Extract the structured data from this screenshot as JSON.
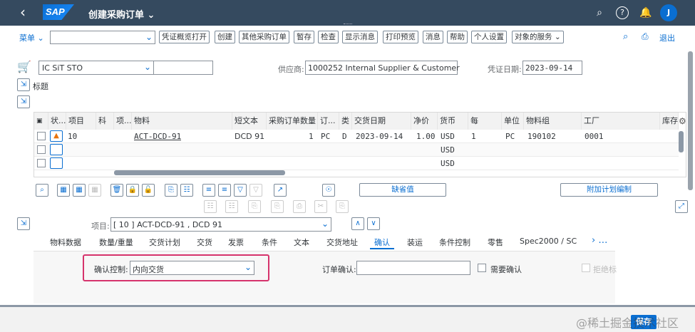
{
  "shell": {
    "logo": "SAP",
    "title": "创建采购订单 ⌄",
    "avatar_initial": "J"
  },
  "toolbar": {
    "menu": "菜单 ⌄",
    "buttons": [
      "凭证概览打开",
      "创建",
      "其他采购订单",
      "暂存",
      "检查",
      "显示消息",
      "打印预览",
      "消息",
      "帮助",
      "个人设置",
      "对象的服务 ⌄"
    ],
    "exit": "退出"
  },
  "header": {
    "doc_type": "IC SiT STO",
    "supplier_label": "供应商:",
    "supplier_value": "1000252 Internal Supplier & Customer",
    "doc_date_label": "凭证日期:",
    "doc_date_value": "2023-09-14",
    "header_label": "标题"
  },
  "table": {
    "columns": [
      "状...",
      "项目",
      "科",
      "项...",
      "物料",
      "短文本",
      "采购订单数量",
      "订...",
      "类",
      "交货日期",
      "净价",
      "货币",
      "每",
      "单位",
      "物料组",
      "工厂",
      "库存"
    ],
    "rows": [
      {
        "item": "10",
        "material": "ACT-DCD-91",
        "short_text": "DCD 91",
        "qty": "1",
        "unit": "PC",
        "cat": "D",
        "delivery_date": "2023-09-14",
        "net_price": "1.00",
        "currency": "USD",
        "per": "1",
        "order_unit": "PC",
        "mat_group": "190102",
        "plant": "0001"
      },
      {
        "currency": "USD"
      },
      {
        "currency": "USD"
      }
    ]
  },
  "actions": {
    "default_values": "缺省值",
    "additional_planning": "附加计划编制"
  },
  "item_detail": {
    "label": "项目:",
    "value": "[ 10 ] ACT-DCD-91 , DCD 91",
    "tabs": [
      "物料数据",
      "数量/重量",
      "交货计划",
      "交货",
      "发票",
      "条件",
      "文本",
      "交货地址",
      "确认",
      "装运",
      "条件控制",
      "零售",
      "Spec2000 / SC"
    ],
    "active_tab": "确认",
    "confirm_control_label": "确认控制:",
    "confirm_control_value": "内向交货",
    "order_confirm_label": "订单确认:",
    "order_confirm_value": "",
    "confirm_required_label": "需要确认",
    "reject_label": "拒绝标"
  },
  "footer": {
    "save": "保存",
    "watermark": "@稀土掘金技术社区"
  },
  "colors": {
    "shell": "#354a5f",
    "accent": "#0a6ed1",
    "highlight": "#d6336c"
  }
}
